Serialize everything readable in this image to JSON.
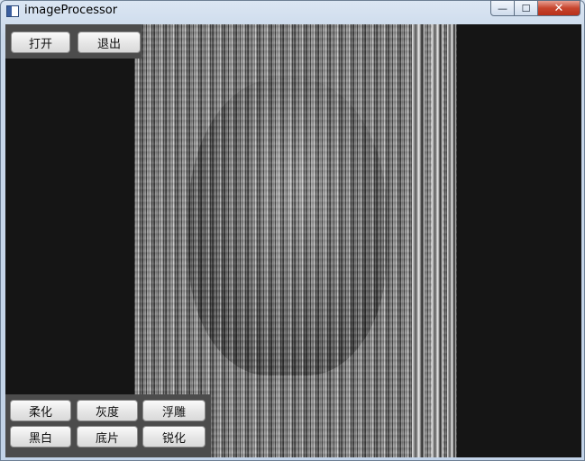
{
  "window": {
    "title": "imageProcessor",
    "controls": {
      "minimize": "—",
      "maximize": "☐",
      "close": "✕"
    }
  },
  "toolbar_top": {
    "open_label": "打开",
    "exit_label": "退出"
  },
  "toolbar_bottom": {
    "soften_label": "柔化",
    "gray_label": "灰度",
    "emboss_label": "浮雕",
    "bw_label": "黑白",
    "negative_label": "底片",
    "sharpen_label": "锐化"
  },
  "colors": {
    "background": "#151515",
    "panel": "#4c4c4c",
    "close_button": "#c7452e"
  }
}
